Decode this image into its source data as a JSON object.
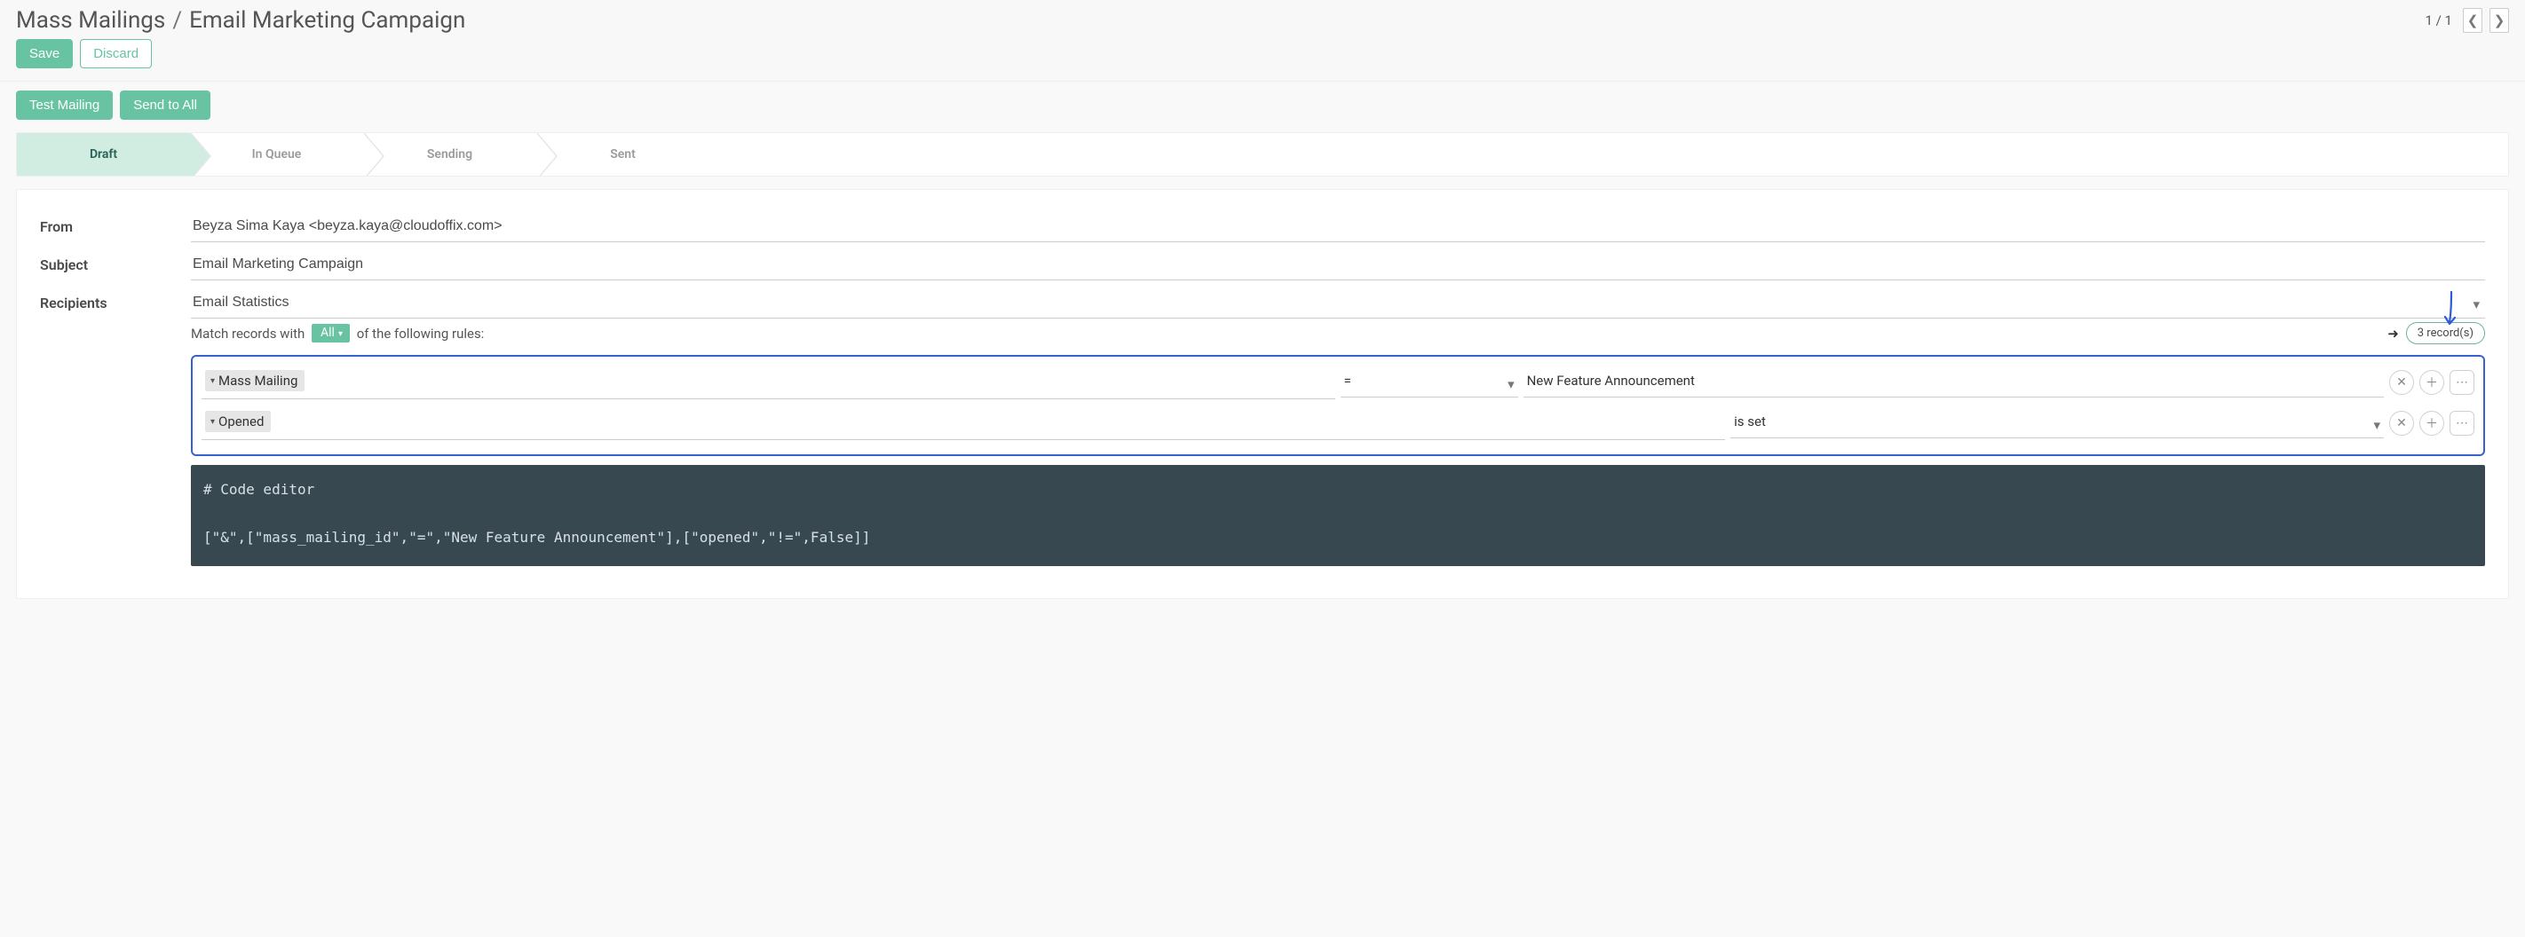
{
  "breadcrumb": {
    "root": "Mass Mailings",
    "sep": "/",
    "current": "Email Marketing Campaign"
  },
  "pager": {
    "text": "1 / 1"
  },
  "buttons": {
    "save": "Save",
    "discard": "Discard",
    "test_mailing": "Test Mailing",
    "send_to_all": "Send to All"
  },
  "status": {
    "steps": [
      "Draft",
      "In Queue",
      "Sending",
      "Sent"
    ],
    "active_index": 0
  },
  "form": {
    "from_label": "From",
    "from_value": "Beyza Sima Kaya <beyza.kaya@cloudoffix.com>",
    "subject_label": "Subject",
    "subject_value": "Email Marketing Campaign",
    "recipients_label": "Recipients",
    "recipients_value": "Email Statistics"
  },
  "match": {
    "prefix": "Match records with ",
    "selector": "All",
    "suffix": " of the following rules:"
  },
  "records": {
    "count_text": "3 record(s)"
  },
  "filters": [
    {
      "field": "Mass Mailing",
      "operator": "=",
      "has_value": true,
      "value": "New Feature Announcement"
    },
    {
      "field": "Opened",
      "operator": "is set",
      "has_value": false,
      "value": ""
    }
  ],
  "code": {
    "comment": "# Code editor",
    "body": "[\"&\",[\"mass_mailing_id\",\"=\",\"New Feature Announcement\"],[\"opened\",\"!=\",False]]"
  },
  "chart_data": null
}
